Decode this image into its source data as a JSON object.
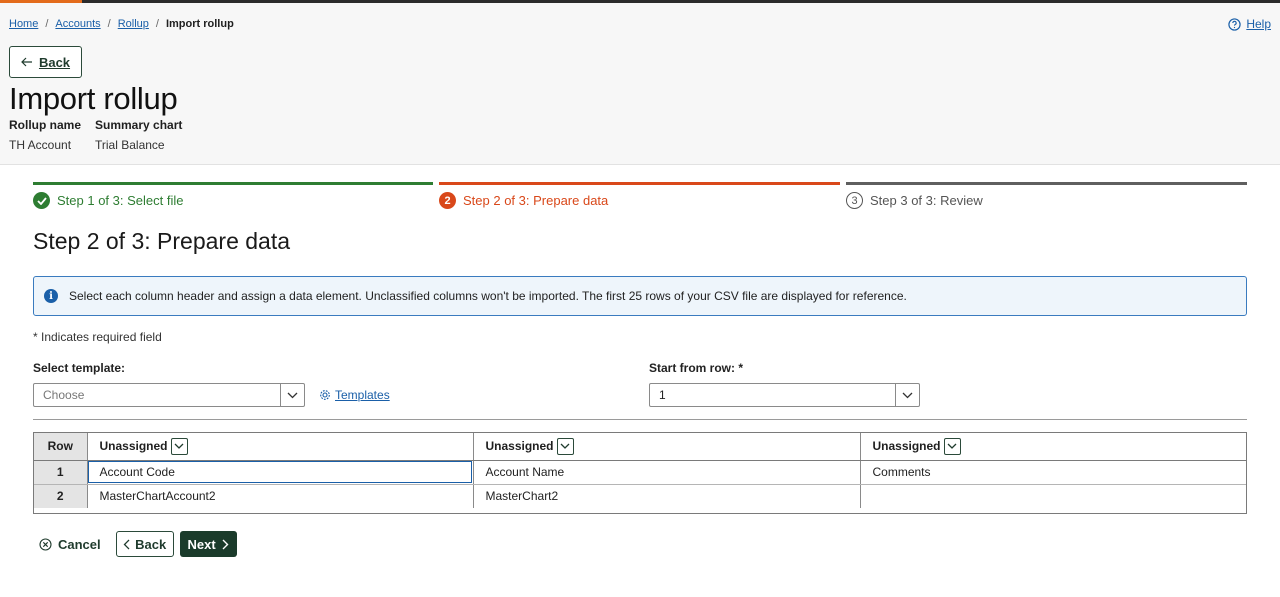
{
  "breadcrumb": {
    "items": [
      "Home",
      "Accounts",
      "Rollup"
    ],
    "current": "Import rollup",
    "separator": "/"
  },
  "help": {
    "label": "Help",
    "icon": "help-circle-icon"
  },
  "header": {
    "back_label": "Back",
    "title": "Import rollup",
    "meta": [
      {
        "label": "Rollup name",
        "value": "TH Account"
      },
      {
        "label": "Summary chart",
        "value": "Trial Balance"
      }
    ]
  },
  "stepper": {
    "steps": [
      {
        "label": "Step 1 of 3: Select file",
        "status": "complete",
        "marker": ""
      },
      {
        "label": "Step 2 of 3: Prepare data",
        "status": "current",
        "marker": "2"
      },
      {
        "label": "Step 3 of 3: Review",
        "status": "upcoming",
        "marker": "3"
      }
    ]
  },
  "main": {
    "heading": "Step 2 of 3: Prepare data",
    "info": {
      "icon": "info-icon",
      "message": "Select each column header and assign a data element. Unclassified columns won't be imported. The first 25 rows of your CSV file are displayed for reference."
    },
    "required_note": "* Indicates required field",
    "template": {
      "label": "Select template:",
      "placeholder": "Choose"
    },
    "templates_link": "Templates",
    "start_row": {
      "label": "Start from row: *",
      "value": "1"
    }
  },
  "grid": {
    "row_header": "Row",
    "columns": [
      "Unassigned",
      "Unassigned",
      "Unassigned"
    ],
    "rows": [
      {
        "num": "1",
        "cells": [
          "Account Code",
          "Account Name",
          "Comments"
        ]
      },
      {
        "num": "2",
        "cells": [
          "MasterChartAccount2",
          "MasterChart2",
          ""
        ]
      }
    ]
  },
  "actions": {
    "cancel": "Cancel",
    "back": "Back",
    "next": "Next"
  },
  "colors": {
    "complete": "#2e7d32",
    "current": "#d9481a",
    "upcoming": "#5f5f5f",
    "link": "#1a5fa8",
    "primary_button": "#1b3b2b",
    "top_accent": "#e36b1b"
  }
}
